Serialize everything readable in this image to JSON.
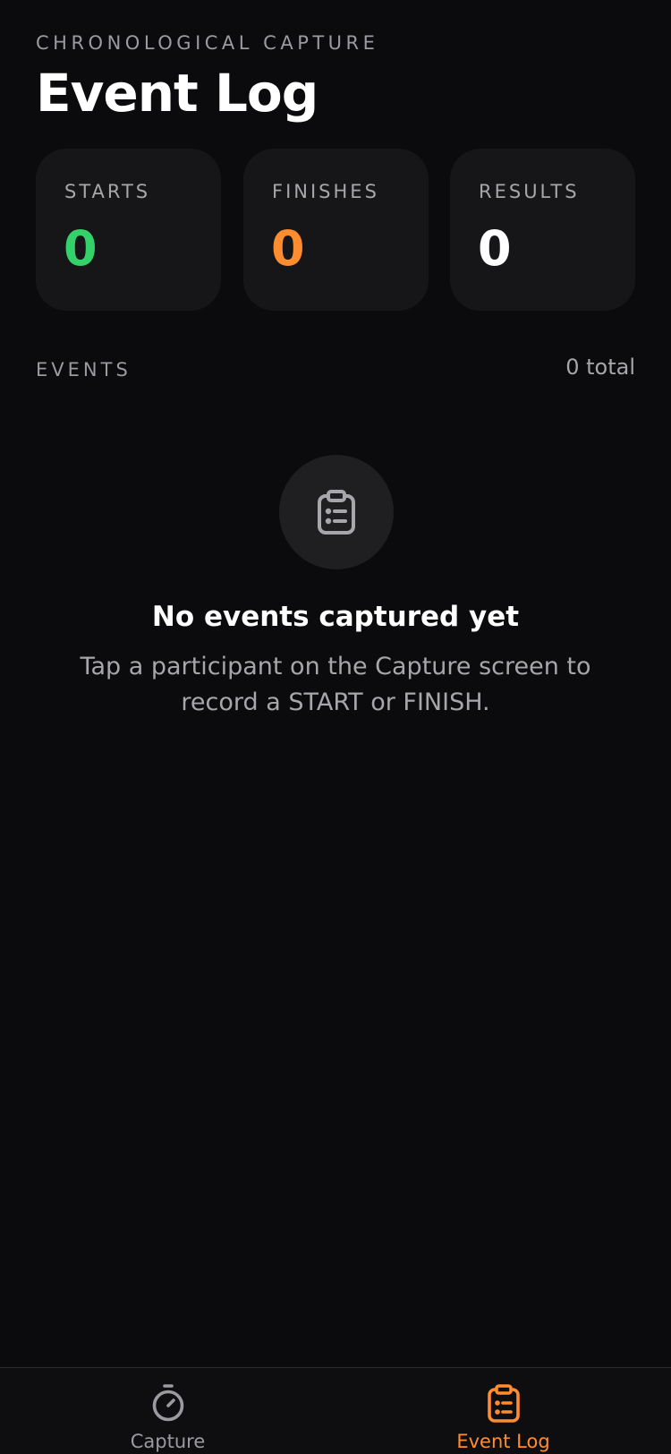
{
  "header": {
    "eyebrow": "CHRONOLOGICAL CAPTURE",
    "title": "Event Log"
  },
  "stats": [
    {
      "label": "STARTS",
      "value": "0",
      "color": "#34d16b"
    },
    {
      "label": "FINISHES",
      "value": "0",
      "color": "#ff8c2e"
    },
    {
      "label": "RESULTS",
      "value": "0",
      "color": "#ffffff"
    }
  ],
  "events": {
    "label": "EVENTS",
    "count": "0 total"
  },
  "empty_state": {
    "icon": "clipboard-list-icon",
    "title": "No events captured yet",
    "description": "Tap a participant on the Capture screen to record a START or FINISH."
  },
  "tabbar": {
    "tabs": [
      {
        "label": "Capture",
        "icon": "stopwatch-icon",
        "active": false,
        "color": "#9a9aa0"
      },
      {
        "label": "Event Log",
        "icon": "clipboard-list-icon",
        "active": true,
        "color": "#ff8c2e"
      }
    ]
  }
}
